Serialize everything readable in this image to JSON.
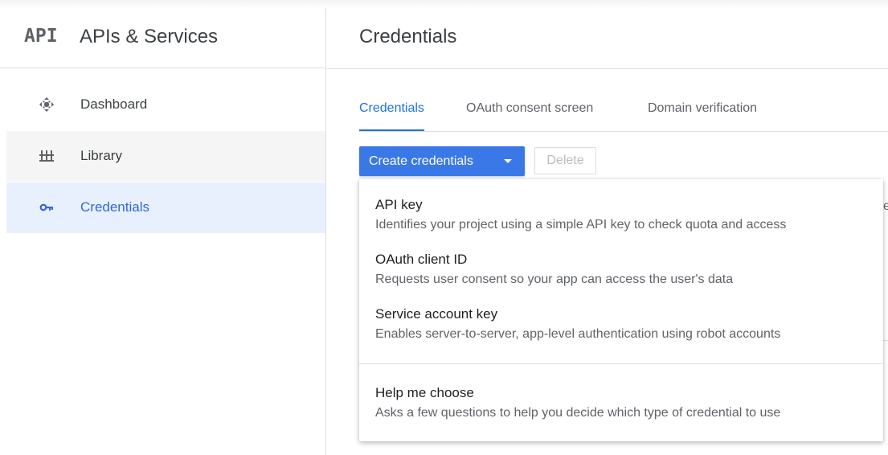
{
  "sidebar": {
    "logo": "API",
    "title": "APIs & Services",
    "items": [
      {
        "label": "Dashboard",
        "icon": "dashboard-icon",
        "state": "normal"
      },
      {
        "label": "Library",
        "icon": "library-icon",
        "state": "hover"
      },
      {
        "label": "Credentials",
        "icon": "key-icon",
        "state": "selected"
      }
    ]
  },
  "main": {
    "title": "Credentials",
    "tabs": [
      {
        "label": "Credentials",
        "active": true
      },
      {
        "label": "OAuth consent screen",
        "active": false
      },
      {
        "label": "Domain verification",
        "active": false
      }
    ],
    "create_button": "Create credentials",
    "delete_button": "Delete",
    "menu": {
      "items": [
        {
          "title": "API key",
          "description": "Identifies your project using a simple API key to check quota and access"
        },
        {
          "title": "OAuth client ID",
          "description": "Requests user consent so your app can access the user's data"
        },
        {
          "title": "Service account key",
          "description": "Enables server-to-server, app-level authentication using robot accounts"
        },
        {
          "title": "Help me choose",
          "description": "Asks a few questions to help you decide which type of credential to use"
        }
      ]
    },
    "edge_text": "e"
  },
  "colors": {
    "accent": "#1a73e8",
    "button": "#3b78e7",
    "selected_bg": "#e8f0fe",
    "selected_text": "#3367d6"
  }
}
